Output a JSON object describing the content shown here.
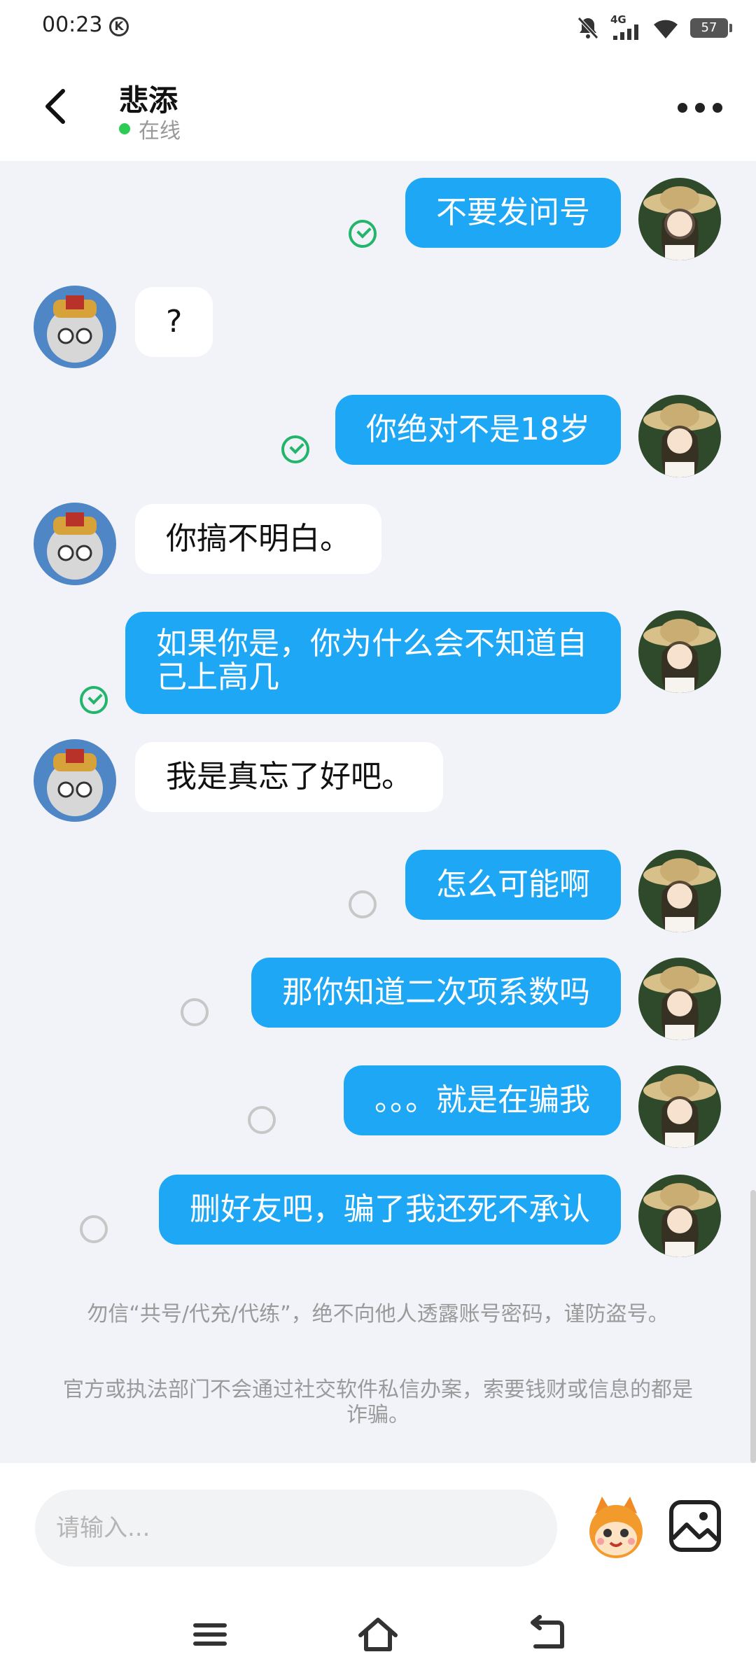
{
  "status_bar": {
    "time": "00:23",
    "k_label": "K",
    "network": "4G",
    "battery": "57"
  },
  "header": {
    "title": "悲添",
    "online": "在线"
  },
  "messages": [
    {
      "side": "me",
      "text": "不要发问号",
      "state": "read"
    },
    {
      "side": "other",
      "text": "?"
    },
    {
      "side": "me",
      "text": "你绝对不是18岁",
      "state": "read"
    },
    {
      "side": "other",
      "text": "你搞不明白。"
    },
    {
      "side": "me",
      "text": "如果你是，你为什么会不知道自己上高几",
      "state": "read"
    },
    {
      "side": "other",
      "text": "我是真忘了好吧。"
    },
    {
      "side": "me",
      "text": "怎么可能啊",
      "state": "sent"
    },
    {
      "side": "me",
      "text": "那你知道二次项系数吗",
      "state": "sent"
    },
    {
      "side": "me",
      "text": "。。。就是在骗我",
      "state": "sent"
    },
    {
      "side": "me",
      "text": "删好友吧，骗了我还死不承认",
      "state": "sent"
    }
  ],
  "notices": [
    "勿信“共号/代充/代练”，绝不向他人透露账号密码，谨防盗号。",
    "官方或执法部门不会通过社交软件私信办案，索要钱财或信息的都是诈骗。"
  ],
  "input": {
    "placeholder": "请输入..."
  },
  "icons": {
    "back": "chevron-left-icon",
    "more": "more-dots-icon",
    "emoji": "mascot-emoji-icon",
    "image": "image-icon",
    "menu": "menu-icon",
    "home": "home-icon",
    "return": "back-arrow-icon"
  },
  "colors": {
    "my_bubble": "#1ea7f5",
    "other_bubble": "#ffffff",
    "background": "#f2f3f8",
    "read_check": "#22b56b",
    "online_dot": "#2ecc55"
  }
}
